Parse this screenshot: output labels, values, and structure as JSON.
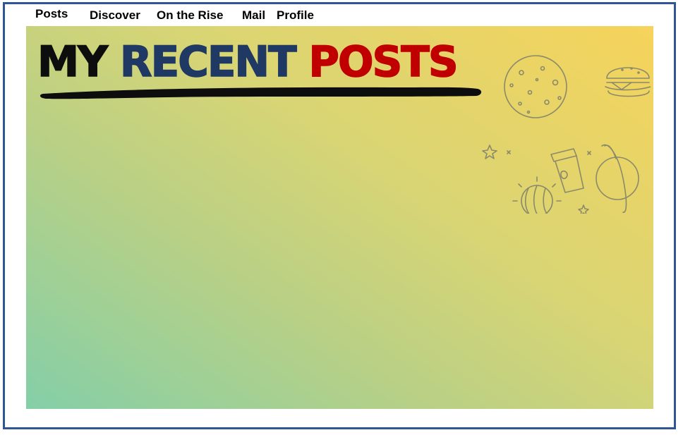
{
  "nav": {
    "items": [
      {
        "label": "Posts"
      },
      {
        "label": "Discover"
      },
      {
        "label": "On the Rise"
      },
      {
        "label": "Mail"
      },
      {
        "label": "Profile"
      }
    ]
  },
  "hero": {
    "title_part1": "MY",
    "title_part2": "RECENT",
    "title_part3": "POSTS"
  },
  "colors": {
    "frame_border": "#2f5597",
    "title_my": "#0d0d0d",
    "title_recent": "#1f3864",
    "title_posts": "#c00000",
    "gradient_start": "#84cfa8",
    "gradient_end": "#f6d35b"
  },
  "icons": [
    "planet-icon",
    "burger-icon",
    "coffee-cup-icon",
    "ringed-planet-icon",
    "striped-planet-icon",
    "star-icon",
    "sparkle-icon"
  ]
}
